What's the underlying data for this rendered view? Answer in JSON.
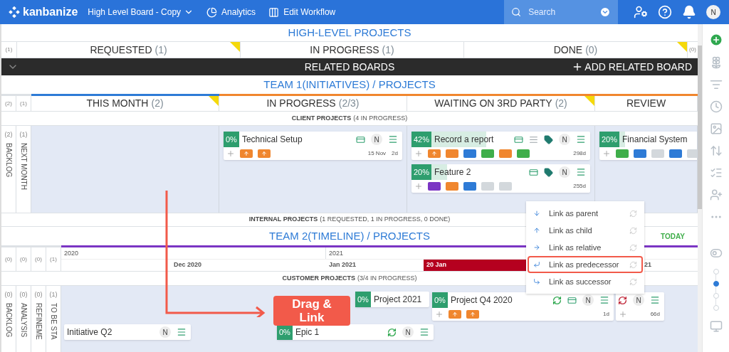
{
  "topbar": {
    "logo": "kanbanize",
    "board": "High Level Board - Copy",
    "nav": [
      {
        "kind": "analytics",
        "label": "Analytics"
      },
      {
        "kind": "workflow",
        "label": "Edit Workflow"
      }
    ],
    "search": {
      "placeholder": "Search"
    },
    "avatar": "N"
  },
  "high_level": {
    "title": "HIGH-LEVEL PROJECTS",
    "left_count": "(1)",
    "right_count": "(0)",
    "columns": [
      {
        "label": "REQUESTED",
        "count": "(1)",
        "flagged": true
      },
      {
        "label": "IN PROGRESS",
        "count": "(1)",
        "flagged": false
      },
      {
        "label": "DONE",
        "count": "(0)",
        "flagged": true
      }
    ]
  },
  "related_boards": {
    "label": "RELATED BOARDS",
    "add": "ADD RELATED BOARD",
    "expanded": false
  },
  "team1": {
    "title": "TEAM 1(INITIATIVES) / PROJECTS",
    "counts": [
      "(2)",
      "(1)"
    ],
    "columns": [
      {
        "label": "THIS MONTH",
        "count": "(2)",
        "color": "#2e7bd6",
        "flagged": true
      },
      {
        "label": "IN PROGRESS",
        "count": "(2/3)",
        "color": "#f0862e",
        "flagged": false,
        "cards": [
          {
            "progress": "0%",
            "title": "Technical Setup",
            "icons": [
              {
                "kind": "board"
              },
              {
                "kind": "avatar",
                "text": "N"
              },
              {
                "kind": "menu"
              }
            ],
            "tags": [
              {
                "kind": "arrow",
                "color": "#f0862e"
              },
              {
                "kind": "arrow",
                "color": "#f0862e"
              }
            ],
            "date": "15 Nov",
            "age": "2d"
          }
        ]
      },
      {
        "label": "WAITING ON 3RD PARTY",
        "count": "(2)",
        "color": "#f0862e",
        "flagged": true,
        "cards": [
          {
            "progress": "42%",
            "level": 0.42,
            "title": "Record a report",
            "icons": [
              {
                "kind": "board"
              },
              {
                "kind": "lines"
              },
              {
                "kind": "tag"
              },
              {
                "kind": "avatar",
                "text": "N"
              },
              {
                "kind": "menu"
              }
            ],
            "tags": [
              {
                "kind": "arrow",
                "color": "#f0862e"
              },
              {
                "kind": "plain",
                "color": "#f0862e"
              },
              {
                "kind": "plain",
                "color": "#2e7bd6"
              },
              {
                "kind": "plain",
                "color": "#3fae4a"
              },
              {
                "kind": "plain",
                "color": "#f0862e"
              },
              {
                "kind": "plain",
                "color": "#3fae4a"
              }
            ],
            "age": "298d"
          },
          {
            "progress": "20%",
            "level": 0.2,
            "title": "Feature 2",
            "icons": [
              {
                "kind": "board"
              },
              {
                "kind": "tag"
              },
              {
                "kind": "avatar",
                "text": "N"
              },
              {
                "kind": "menu"
              }
            ],
            "tags": [
              {
                "kind": "plain",
                "color": "#7b35c4"
              },
              {
                "kind": "plain",
                "color": "#f0862e"
              },
              {
                "kind": "plain",
                "color": "#2e7bd6"
              },
              {
                "kind": "plain",
                "color": "#d3d8dc"
              },
              {
                "kind": "plain",
                "color": "#d3d8dc"
              }
            ],
            "age": "255d"
          }
        ]
      },
      {
        "label": "REVIEW",
        "color": "#f0862e",
        "flagged": false,
        "cards": [
          {
            "progress": "20%",
            "level": 0.2,
            "title": "Financial System",
            "tags": [
              {
                "kind": "plain",
                "color": "#3fae4a"
              },
              {
                "kind": "plain",
                "color": "#2e7bd6"
              },
              {
                "kind": "plain",
                "color": "#d3d8dc"
              },
              {
                "kind": "plain",
                "color": "#2e7bd6"
              },
              {
                "kind": "plain",
                "color": "#d3d8dc"
              }
            ]
          }
        ]
      }
    ],
    "lane": {
      "title": "CLIENT PROJECTS",
      "count": "(4 IN PROGRESS)"
    },
    "side_lanes": [
      {
        "count": "(2)",
        "label": "BACKLOG"
      },
      {
        "count": "(1)",
        "label": "NEXT MONTH"
      }
    ],
    "footer": {
      "title": "INTERNAL PROJECTS",
      "count": "(1 REQUESTED, 1 IN PROGRESS, 0 DONE)"
    }
  },
  "team2": {
    "title": "TEAM 2(TIMELINE) / PROJECTS",
    "today": "TODAY",
    "counts": [
      "(0)",
      "(0)",
      "(0)",
      "(1)"
    ],
    "years": [
      "2020",
      "2021"
    ],
    "months": [
      "Dec 2020",
      "Jan 2021"
    ],
    "today_marker": "20 Jan",
    "next_month": "21",
    "lane": {
      "title": "CUSTOMER PROJECTS",
      "count": "(3/4 IN PROGRESS)"
    },
    "side_lanes": [
      {
        "count": "(0)",
        "label": "BACKLOG"
      },
      {
        "count": "(0)",
        "label": "ANALYSIS"
      },
      {
        "count": "(0)",
        "label": "REFINEME"
      },
      {
        "count": "(1)",
        "label": "TO BE STA"
      }
    ],
    "cards": [
      {
        "progress": "0%",
        "title": "Project 2021"
      },
      {
        "progress": "0%",
        "title": "Project Q4 2020",
        "icons": [
          {
            "kind": "cycle",
            "color": "#2fa84f"
          },
          {
            "kind": "board"
          },
          {
            "kind": "avatar",
            "text": "N"
          },
          {
            "kind": "menu"
          }
        ],
        "tags": [
          {
            "kind": "arrow",
            "color": "#f0862e"
          },
          {
            "kind": "arrow",
            "color": "#f0862e"
          }
        ],
        "age": "1d"
      },
      {
        "icons": [
          {
            "kind": "cycle",
            "color": "#c0283a"
          },
          {
            "kind": "avatar",
            "text": "N"
          },
          {
            "kind": "menu"
          }
        ],
        "age": "66d"
      },
      {
        "title": "Initiative Q2",
        "icons": [
          {
            "kind": "avatar",
            "text": "N"
          },
          {
            "kind": "menu"
          }
        ]
      },
      {
        "progress": "0%",
        "title": "Epic 1",
        "icons": [
          {
            "kind": "cycle",
            "color": "#2fa84f"
          },
          {
            "kind": "avatar",
            "text": "N"
          },
          {
            "kind": "menu"
          }
        ]
      }
    ]
  },
  "drag_label": "Drag & Link",
  "link_menu": [
    {
      "kind": "parent",
      "label": "Link as parent",
      "selected": false
    },
    {
      "kind": "child",
      "label": "Link as child",
      "selected": false
    },
    {
      "kind": "relative",
      "label": "Link as relative",
      "selected": false
    },
    {
      "kind": "predecessor",
      "label": "Link as predecessor",
      "selected": true
    },
    {
      "kind": "successor",
      "label": "Link as successor",
      "selected": false
    }
  ],
  "sidebar": {
    "zoom_steps": [
      {
        "selected": false
      },
      {
        "selected": true
      },
      {
        "selected": false
      },
      {
        "selected": false
      }
    ]
  }
}
